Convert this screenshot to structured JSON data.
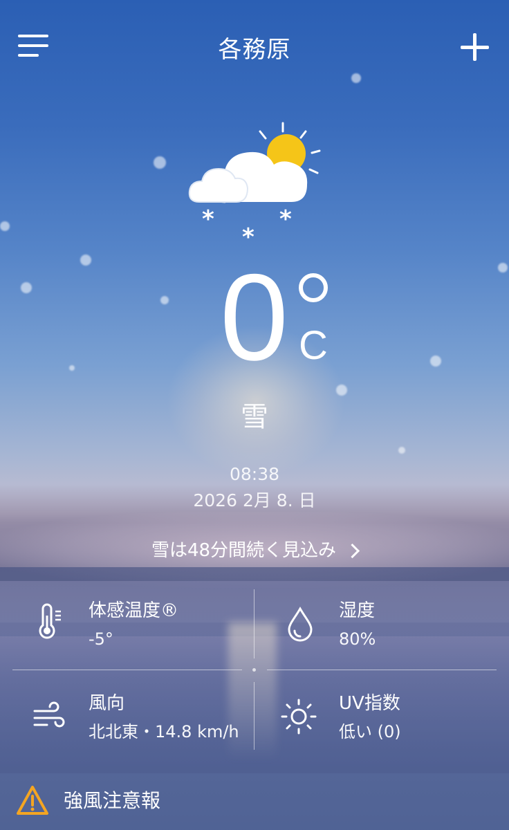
{
  "header": {
    "city": "各務原",
    "menu_icon": "hamburger-menu-icon",
    "add_icon": "plus-icon"
  },
  "current": {
    "weather_icon": "partly-cloudy-snow-icon",
    "temperature": "0",
    "unit": "C",
    "condition": "雪",
    "time": "08:38",
    "date": "2026 2月 8. 日"
  },
  "forecast_link": {
    "label": "雪は48分間続く見込み"
  },
  "details": [
    {
      "title": "体感温度®",
      "value": "-5°",
      "icon": "thermometer-icon"
    },
    {
      "title": "湿度",
      "value": "80%",
      "icon": "water-drop-icon"
    },
    {
      "title": "風向",
      "value": "北北東・14.8 km/h",
      "icon": "wind-icon"
    },
    {
      "title": "UV指数",
      "value": "低い (0)",
      "icon": "sun-icon"
    }
  ],
  "alert": {
    "label": "強風注意報",
    "icon": "warning-icon",
    "color": "#f4a522"
  },
  "colors": {
    "sun": "#f5c518",
    "text": "#ffffff"
  }
}
